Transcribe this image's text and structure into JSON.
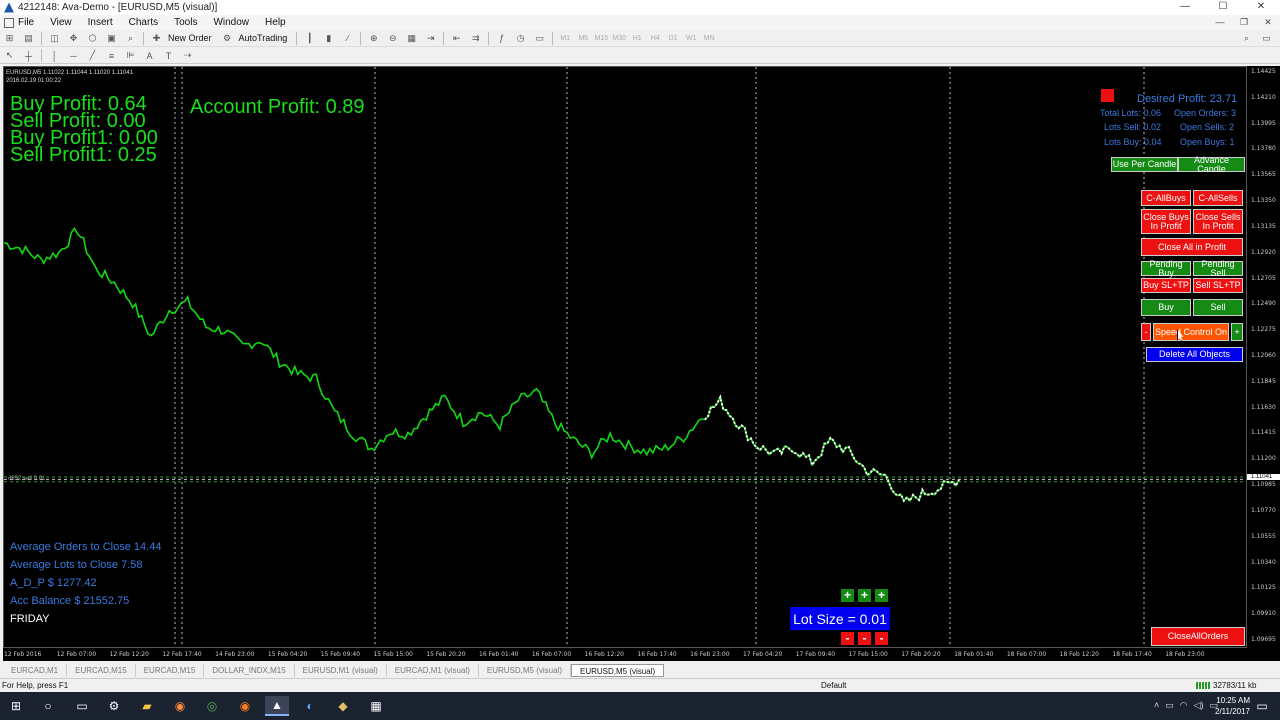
{
  "window": {
    "title": "4212148: Ava-Demo - [EURUSD,M5 (visual)]"
  },
  "menu": [
    "File",
    "View",
    "Insert",
    "Charts",
    "Tools",
    "Window",
    "Help"
  ],
  "toolbar": {
    "new_order": "New Order",
    "autotrading": "AutoTrading",
    "timeframes": [
      "M1",
      "M5",
      "M15",
      "M30",
      "H1",
      "H4",
      "D1",
      "W1",
      "MN"
    ]
  },
  "chart": {
    "symbol_info": "EURUSD,M5  1.11022 1.11044 1.11020 1.11041",
    "datetime": "2016.02.19 01:00:22",
    "stop_label": "#852 sell 0.01",
    "current_price": "1.11041",
    "y_ticks": [
      "1.14425",
      "1.14210",
      "1.13995",
      "1.13780",
      "1.13565",
      "1.13350",
      "1.13135",
      "1.12920",
      "1.12705",
      "1.12490",
      "1.12275",
      "1.12060",
      "1.11845",
      "1.11630",
      "1.11415",
      "1.11200",
      "1.10985",
      "1.10770",
      "1.10555",
      "1.10340",
      "1.10125",
      "1.09910",
      "1.09695"
    ],
    "x_ticks": [
      "12 Feb 2016",
      "12 Feb 07:00",
      "12 Feb 12:20",
      "12 Feb 17:40",
      "14 Feb 23:00",
      "15 Feb 04:20",
      "15 Feb 09:40",
      "15 Feb 15:00",
      "15 Feb 20:20",
      "16 Feb 01:40",
      "16 Feb 07:00",
      "16 Feb 12:20",
      "16 Feb 17:40",
      "16 Feb 23:00",
      "17 Feb 04:20",
      "17 Feb 09:40",
      "17 Feb 15:00",
      "17 Feb 20:20",
      "18 Feb 01:40",
      "18 Feb 07:00",
      "18 Feb 12:20",
      "18 Feb 17:40",
      "18 Feb 23:00"
    ]
  },
  "overlay": {
    "buy_profit": "Buy Profit: 0.64",
    "sell_profit": "Sell Profit: 0.00",
    "buy_profit1": "Buy Profit1: 0.00",
    "sell_profit1": "Sell Profit1: 0.25",
    "account_profit": "Account Profit: 0.89",
    "avg_orders": "Average Orders to Close  14.44",
    "avg_lots": "Average Lots to Close  7.58",
    "adp": "A_D_P $  1277.42",
    "acc_balance": "Acc Balance $  21552.75",
    "day": "FRIDAY",
    "desired_profit": "Desired Profit: 23.71",
    "total_lots": "Total Lots: 0.06",
    "open_orders": "Open Orders: 3",
    "lots_sell": "Lots Sell: 0.02",
    "open_sells": "Open Sells: 2",
    "lots_buy": "Lots Buy: 0.04",
    "open_buys": "Open Buys: 1",
    "lot_size": "Lot Size = 0.01"
  },
  "panel": {
    "use_per_candle": "Use Per Candle",
    "advance_candle": "Advance Candle",
    "c_allbuys": "C-AllBuys",
    "c_allsells": "C-AllSells",
    "close_buys_profit": "Close Buys In Profit",
    "close_sells_profit": "Close Sells In Profit",
    "close_all_profit": "Close All in Profit",
    "pending_buy": "Pending Buy",
    "pending_sell": "Pending Sell",
    "buy_sltp": "Buy SL+TP",
    "sell_sltp": "Sell SL+TP",
    "buy": "Buy",
    "sell": "Sell",
    "minus": "-",
    "plus": "+",
    "speed_control": "Speed Control On",
    "delete_all": "Delete All Objects",
    "close_all_orders": "CloseAllOrders"
  },
  "tabs": [
    "EURCAD,M1",
    "EURCAD,M15",
    "EURCAD,M15",
    "DOLLAR_INDX,M15",
    "EURUSD,M1 (visual)",
    "EURCAD,M1 (visual)",
    "EURUSD,M5 (visual)",
    "EURUSD,M5 (visual)"
  ],
  "status": {
    "help": "For Help, press F1",
    "profile": "Default",
    "traffic": "32783/11 kb"
  },
  "clock": {
    "time": "10:25 AM",
    "date": "2/11/2017"
  },
  "price_series": [
    1.1301,
    1.1296,
    1.1287,
    1.1293,
    1.1312,
    1.1279,
    1.1268,
    1.1251,
    1.1223,
    1.1245,
    1.1252,
    1.1231,
    1.1228,
    1.1215,
    1.122,
    1.1202,
    1.1192,
    1.1188,
    1.116,
    1.1142,
    1.113,
    1.1144,
    1.1142,
    1.1158,
    1.1172,
    1.1152,
    1.116,
    1.1149,
    1.117,
    1.1177,
    1.1151,
    1.1137,
    1.1126,
    1.1141,
    1.1132,
    1.1127,
    1.113,
    1.1139,
    1.1156,
    1.1169,
    1.115,
    1.1132,
    1.1125,
    1.113,
    1.1118,
    1.1136,
    1.1127,
    1.1111,
    1.1107,
    1.1084,
    1.1092,
    1.1097,
    1.1104
  ]
}
